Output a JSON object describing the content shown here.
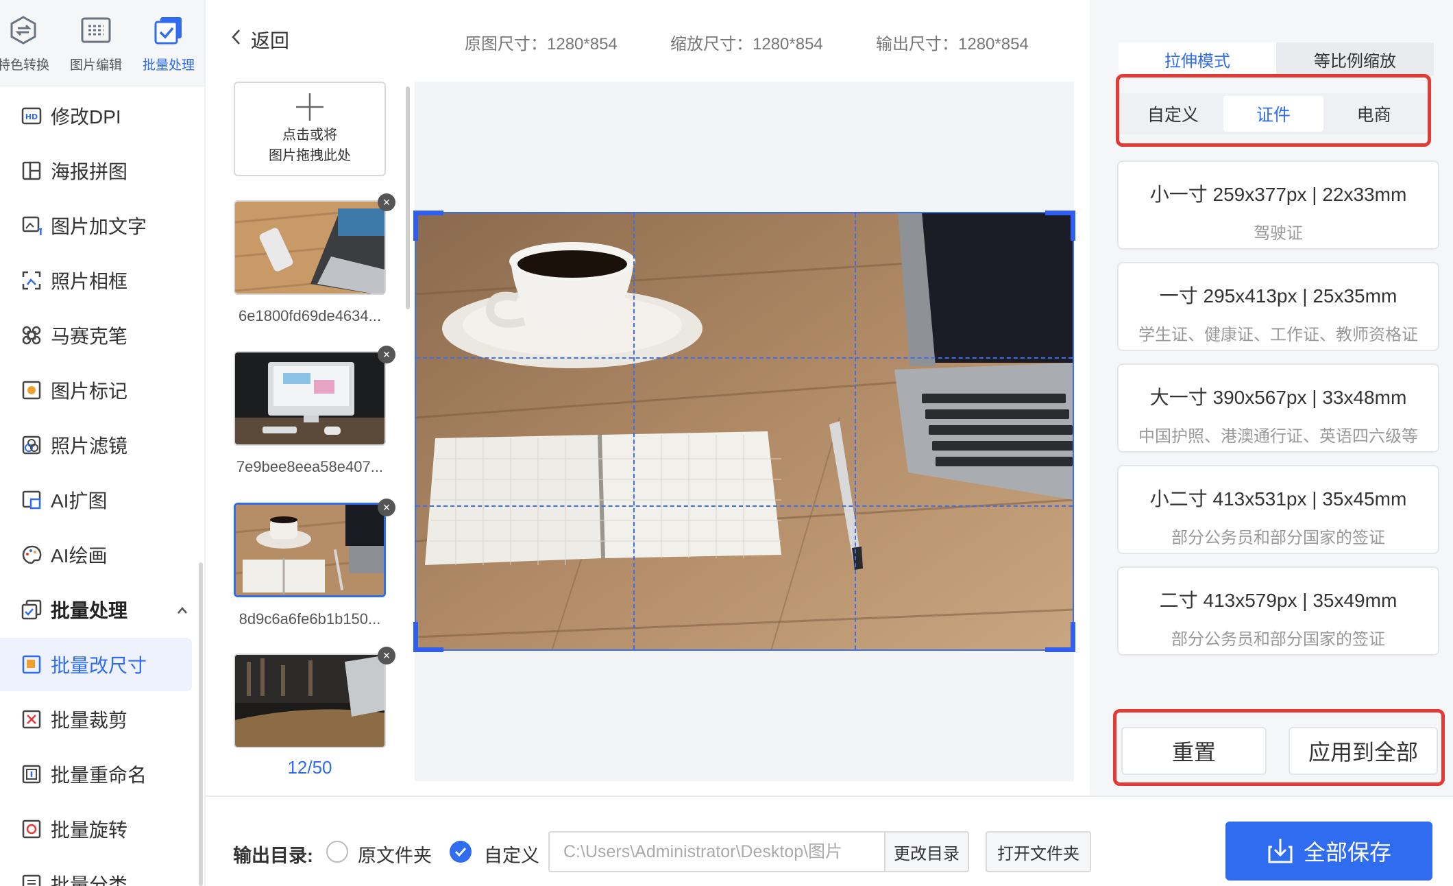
{
  "sidebar": {
    "tabs": [
      {
        "label": "特色转换",
        "icon": "hexagon-convert-icon"
      },
      {
        "label": "图片编辑",
        "icon": "image-edit-icon"
      },
      {
        "label": "批量处理",
        "icon": "batch-check-icon"
      }
    ],
    "items": [
      {
        "label": "修改DPI",
        "icon": "hd-icon"
      },
      {
        "label": "海报拼图",
        "icon": "collage-icon"
      },
      {
        "label": "图片加文字",
        "icon": "image-text-icon"
      },
      {
        "label": "照片相框",
        "icon": "frame-icon"
      },
      {
        "label": "马赛克笔",
        "icon": "mosaic-icon"
      },
      {
        "label": "图片标记",
        "icon": "mark-icon"
      },
      {
        "label": "照片滤镜",
        "icon": "filter-icon"
      },
      {
        "label": "AI扩图",
        "icon": "ai-expand-icon"
      },
      {
        "label": "AI绘画",
        "icon": "palette-icon"
      },
      {
        "label": "批量处理",
        "icon": "batch-icon"
      },
      {
        "label": "批量改尺寸",
        "icon": "resize-icon"
      },
      {
        "label": "批量裁剪",
        "icon": "crop-icon"
      },
      {
        "label": "批量重命名",
        "icon": "rename-icon"
      },
      {
        "label": "批量旋转",
        "icon": "rotate-icon"
      },
      {
        "label": "批量分类",
        "icon": "classify-icon"
      }
    ],
    "group_caret": "^"
  },
  "header": {
    "back": "返回",
    "original_size": "原图尺寸：1280*854",
    "scaled_size": "缩放尺寸：1280*854",
    "output_size": "输出尺寸：1280*854"
  },
  "thumbs": {
    "upload_line1": "点击或将",
    "upload_line2": "图片拖拽此处",
    "files": [
      "6e1800fd69de4634...",
      "7e9bee8eea58e407...",
      "8d9c6a6fe6b1b150..."
    ],
    "close": "×",
    "counter": "12/50"
  },
  "right": {
    "mode_tabs": [
      "拉伸模式",
      "等比例缩放"
    ],
    "segments": [
      "自定义",
      "证件",
      "电商"
    ],
    "presets": [
      {
        "title": "小一寸 259x377px | 22x33mm",
        "desc": "驾驶证"
      },
      {
        "title": "一寸 295x413px | 25x35mm",
        "desc": "学生证、健康证、工作证、教师资格证"
      },
      {
        "title": "大一寸 390x567px | 33x48mm",
        "desc": "中国护照、港澳通行证、英语四六级等"
      },
      {
        "title": "小二寸 413x531px | 35x45mm",
        "desc": "部分公务员和部分国家的签证"
      },
      {
        "title": "二寸 413x579px | 35x49mm",
        "desc": "部分公务员和部分国家的签证"
      }
    ],
    "reset": "重置",
    "apply_all": "应用到全部"
  },
  "bottom": {
    "output_label": "输出目录:",
    "option_original": "原文件夹",
    "option_custom": "自定义",
    "path_value": "C:\\Users\\Administrator\\Desktop\\图片",
    "change_dir": "更改目录",
    "open_folder": "打开文件夹",
    "save_all": "全部保存"
  },
  "colors": {
    "accent": "#2f6cf0",
    "highlight_box": "#e53935"
  }
}
